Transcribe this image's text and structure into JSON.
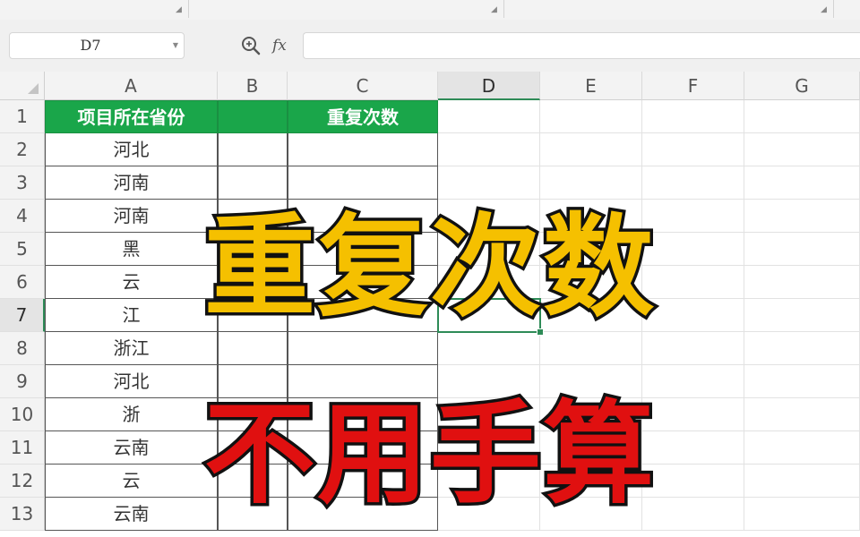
{
  "name_box": {
    "value": "D7"
  },
  "formula_bar": {
    "fx_label": "fx",
    "value": ""
  },
  "columns": [
    "A",
    "B",
    "C",
    "D",
    "E",
    "F",
    "G"
  ],
  "selected_column": "D",
  "rows": [
    "1",
    "2",
    "3",
    "4",
    "5",
    "6",
    "7",
    "8",
    "9",
    "10",
    "11",
    "12",
    "13"
  ],
  "selected_row": "7",
  "sheet": {
    "header_a": "项目所在省份",
    "header_c": "重复次数",
    "column_a_values": [
      "河北",
      "河南",
      "河南",
      "黑",
      "云",
      "江",
      "浙江",
      "河北",
      "浙",
      "云南",
      "云",
      "云南"
    ]
  },
  "overlay": {
    "title_top": "重复次数",
    "title_bottom": "不用手算",
    "top_color": "#f5c000",
    "bottom_color": "#e01010",
    "outline_color": "#111111"
  },
  "colors": {
    "header_fill": "#1aa64a",
    "selection": "#2e8b57"
  }
}
